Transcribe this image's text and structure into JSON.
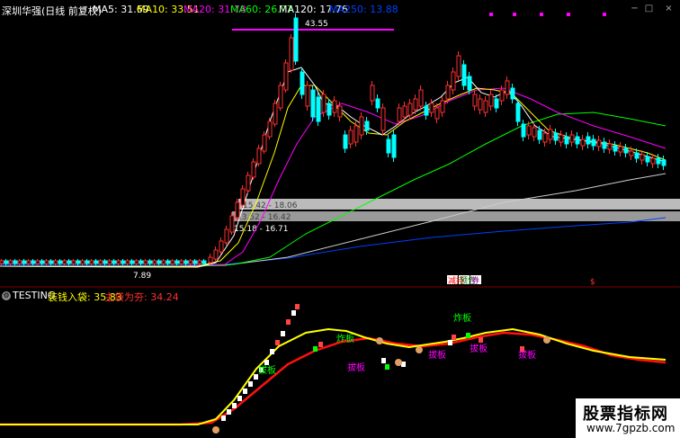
{
  "header": {
    "title": "深圳华强(日线 前复权)",
    "ma": [
      {
        "label": "MA5: 31.69",
        "color": "#ffffff"
      },
      {
        "label": "MA10: 33.51",
        "color": "#ffff00"
      },
      {
        "label": "MA20: 31.78",
        "color": "#ff00ff"
      },
      {
        "label": "MA60: 26.77",
        "color": "#00ff00"
      },
      {
        "label": "MA120: 17.76",
        "color": "#ffffff"
      },
      {
        "label": "MA250: 13.88",
        "color": "#0040ff"
      }
    ]
  },
  "price_chart": {
    "high_label": "43.55",
    "low_label": "7.89",
    "zones": [
      {
        "label": "15.42 - 18.06"
      },
      {
        "label": "13.52 - 16.42"
      },
      {
        "label": "15.18 - 16.71"
      }
    ],
    "marker_labels": [
      "减持",
      "预告",
      "券"
    ]
  },
  "indicator": {
    "name": "TESTING",
    "items": [
      {
        "label": "装钱入袋: 35.83",
        "color": "#ffff00"
      },
      {
        "label": "主袋为夯: 34.24",
        "color": "#ff3030"
      }
    ],
    "signals": [
      "炸板",
      "炸板",
      "拔板",
      "拔板",
      "拔板",
      "拔板"
    ]
  },
  "watermark": {
    "line1": "股票指标网",
    "line2": "www.7gpzb.com"
  },
  "colors": {
    "bull": "#ff3030",
    "bear": "#00ffff",
    "ma5": "#ffffff",
    "ma10": "#ffff00",
    "ma20": "#ff00ff",
    "ma60": "#00ff00",
    "ma120": "#cccccc",
    "ma250": "#0040ff"
  }
}
